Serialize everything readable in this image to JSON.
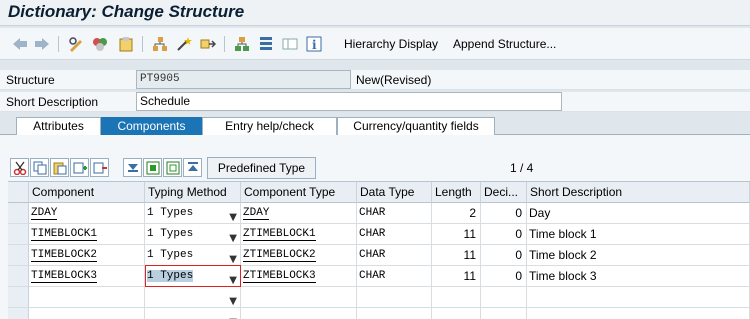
{
  "window": {
    "title": "Dictionary: Change Structure"
  },
  "toolbar": {
    "hierarchy_display": "Hierarchy Display",
    "append_structure": "Append Structure..."
  },
  "fields": {
    "structure_label": "Structure",
    "structure_value": "PT9905",
    "structure_status": "New(Revised)",
    "short_desc_label": "Short Description",
    "short_desc_value": "Schedule"
  },
  "tabs": [
    {
      "label": "Attributes"
    },
    {
      "label": "Components"
    },
    {
      "label": "Entry help/check"
    },
    {
      "label": "Currency/quantity fields"
    }
  ],
  "grid_toolbar": {
    "predefined_type": "Predefined Type",
    "pager": "1  /  4"
  },
  "table": {
    "headers": [
      "Component",
      "Typing Method",
      "Component Type",
      "Data Type",
      "Length",
      "Deci...",
      "Short Description"
    ],
    "rows": [
      {
        "component": "ZDAY",
        "typing": "1 Types",
        "ctype": "ZDAY",
        "dtype": "CHAR",
        "length": "2",
        "dec": "0",
        "desc": "Day"
      },
      {
        "component": "TIMEBLOCK1",
        "typing": "1 Types",
        "ctype": "ZTIMEBLOCK1",
        "dtype": "CHAR",
        "length": "11",
        "dec": "0",
        "desc": "Time block 1"
      },
      {
        "component": "TIMEBLOCK2",
        "typing": "1 Types",
        "ctype": "ZTIMEBLOCK2",
        "dtype": "CHAR",
        "length": "11",
        "dec": "0",
        "desc": "Time block 2"
      },
      {
        "component": "TIMEBLOCK3",
        "typing": "1 Types",
        "ctype": "ZTIMEBLOCK3",
        "dtype": "CHAR",
        "length": "11",
        "dec": "0",
        "desc": "Time block 3"
      }
    ]
  },
  "colors": {
    "active_tab": "#1a74b5",
    "focus_border": "#dd2222",
    "selection": "#b9cfe0"
  }
}
